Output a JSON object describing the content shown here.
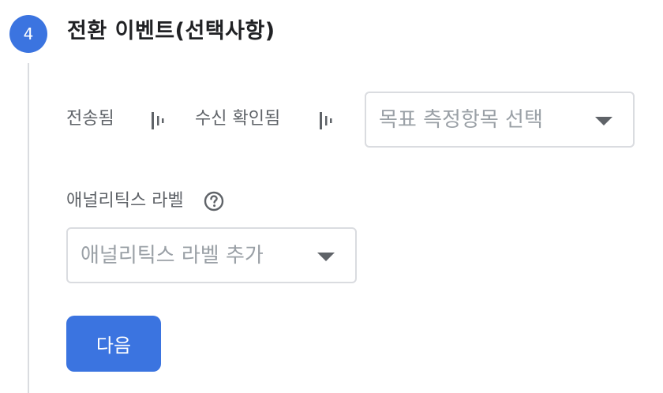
{
  "step": {
    "number": "4",
    "title": "전환 이벤트(선택사항)"
  },
  "conversion": {
    "sent_label": "전송됨",
    "received_label": "수신 확인됨",
    "goal_select": {
      "placeholder": "목표 측정항목 선택"
    }
  },
  "analytics": {
    "label": "애널리틱스 라벨",
    "select": {
      "placeholder": "애널리틱스 라벨 추가"
    }
  },
  "actions": {
    "next_label": "다음"
  },
  "colors": {
    "accent": "#3b74e0",
    "border": "#dadce0",
    "placeholder": "#9aa0a6"
  }
}
